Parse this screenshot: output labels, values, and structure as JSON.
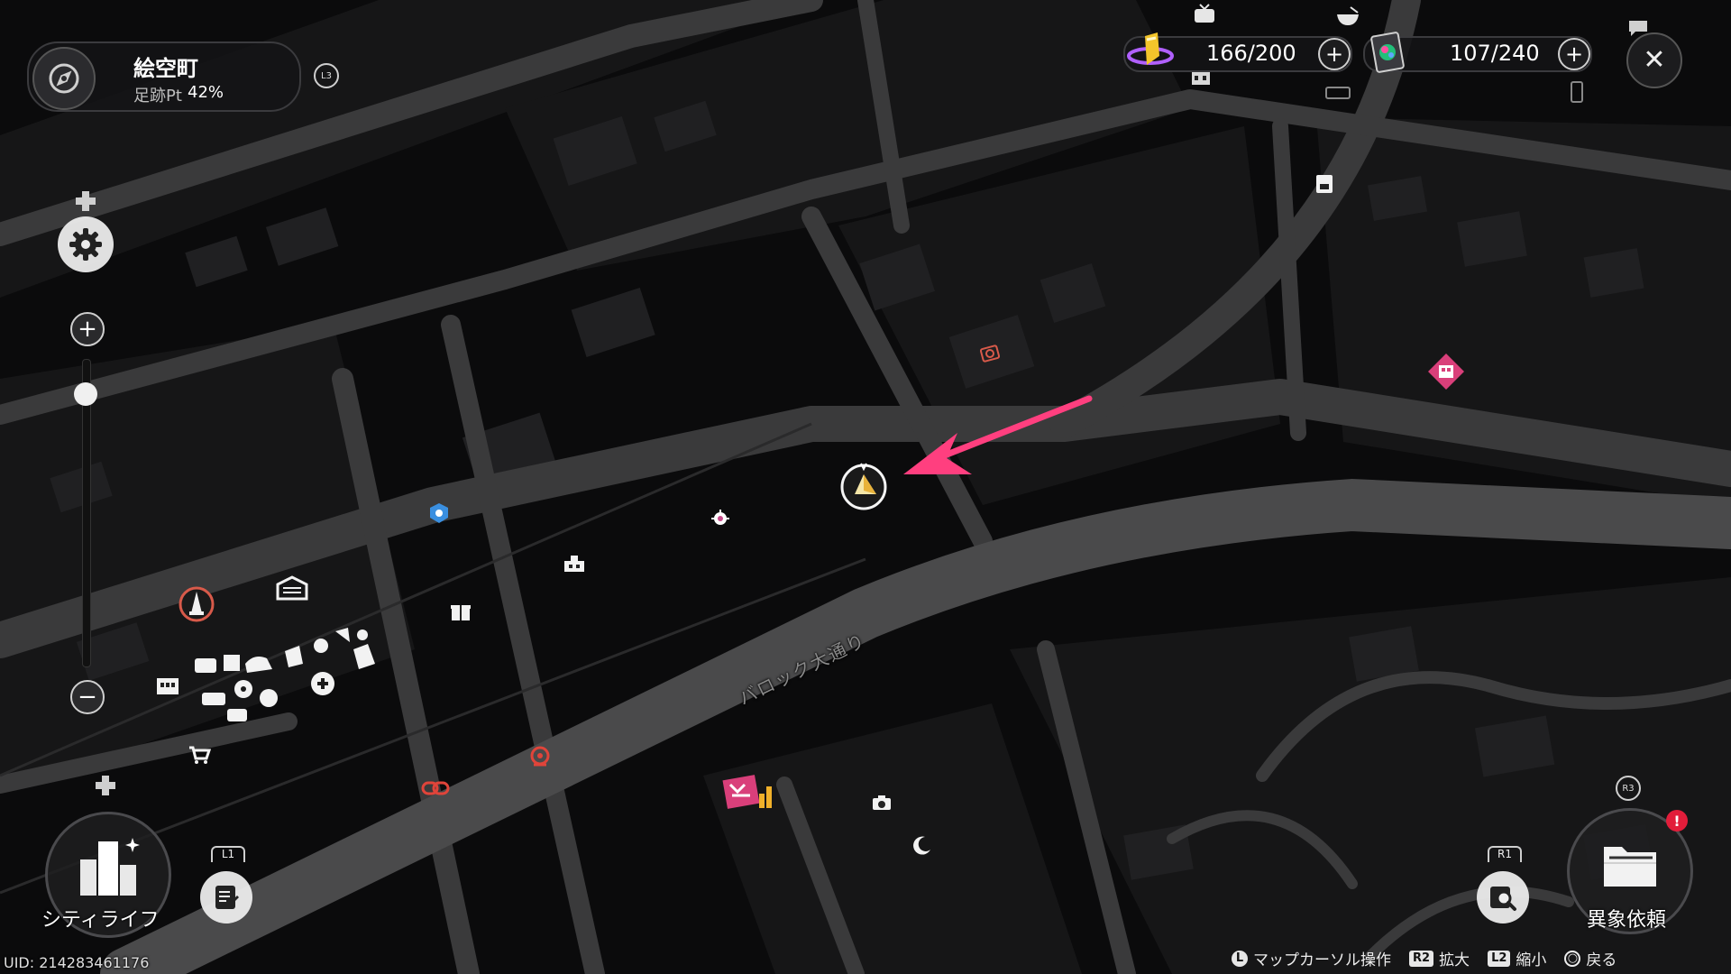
{
  "area": {
    "name": "絵空町",
    "progress_label": "足跡Pt",
    "progress_value": "42%",
    "stick_hint": "L3"
  },
  "resources": {
    "stamina": {
      "value": "166/200",
      "icon": "stamina-crystal-icon"
    },
    "collection": {
      "value": "107/240",
      "icon": "card-pack-icon"
    }
  },
  "street_label": "バロック大通り",
  "city_life": {
    "label": "シティライフ"
  },
  "list_button": {
    "shoulder": "L1"
  },
  "search_button": {
    "shoulder": "R1"
  },
  "anomaly_request": {
    "label": "異象依頼",
    "stick": "R3",
    "alert": "!"
  },
  "uid": "UID: 214283461176",
  "controls": [
    {
      "key": "L",
      "label": "マップカーソル操作"
    },
    {
      "key": "R2",
      "label": "拡大"
    },
    {
      "key": "L2",
      "label": "縮小"
    },
    {
      "key": "○",
      "label": "戻る"
    }
  ],
  "colors": {
    "accent_pink": "#ff3f7f",
    "road": "#3a3a3b",
    "background": "#0b0b0c"
  }
}
